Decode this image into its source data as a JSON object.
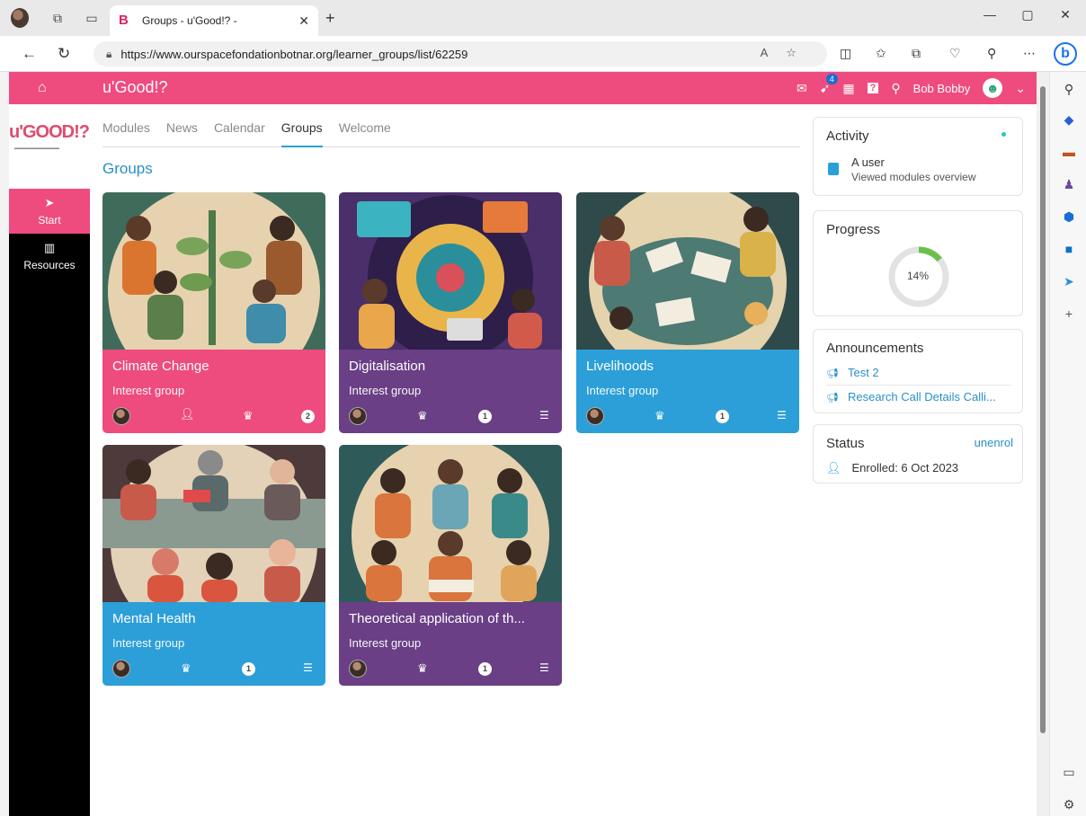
{
  "browser": {
    "tab_title": "Groups - u'Good!? -",
    "tab_favicon": "B",
    "url": "https://www.ourspacefondationbotnar.org/learner_groups/list/62259",
    "bing_label": "b"
  },
  "topnav": {
    "brand": "u'Good!?",
    "notif_count": "4",
    "user_name": "Bob Bobby"
  },
  "leftbar": {
    "logo": "u'GOOD!?",
    "items": [
      {
        "label": "Start",
        "icon": "paper-plane-icon"
      },
      {
        "label": "Resources",
        "icon": "books-icon"
      }
    ]
  },
  "tabs": [
    "Modules",
    "News",
    "Calendar",
    "Groups",
    "Welcome"
  ],
  "active_tab": "Groups",
  "section_title": "Groups",
  "groups": [
    {
      "title": "Climate Change",
      "type": "Interest group",
      "count": "2",
      "color": "#ee4b7e"
    },
    {
      "title": "Digitalisation",
      "type": "Interest group",
      "count": "1",
      "color": "#6a3f86"
    },
    {
      "title": "Livelihoods",
      "type": "Interest group",
      "count": "1",
      "color": "#2c9fd8"
    },
    {
      "title": "Mental Health",
      "type": "Interest group",
      "count": "1",
      "color": "#2c9fd8"
    },
    {
      "title": "Theoretical application of th...",
      "type": "Interest group",
      "count": "1",
      "color": "#6a3f86"
    }
  ],
  "activity": {
    "title": "Activity",
    "user": "A user",
    "action": "Viewed modules overview"
  },
  "progress": {
    "title": "Progress",
    "percent": 14,
    "label": "14%"
  },
  "announcements": {
    "title": "Announcements",
    "items": [
      "Test 2",
      "Research Call Details Calli..."
    ]
  },
  "status": {
    "title": "Status",
    "unenrol": "unenrol",
    "enrolled": "Enrolled: 6 Oct 2023"
  }
}
